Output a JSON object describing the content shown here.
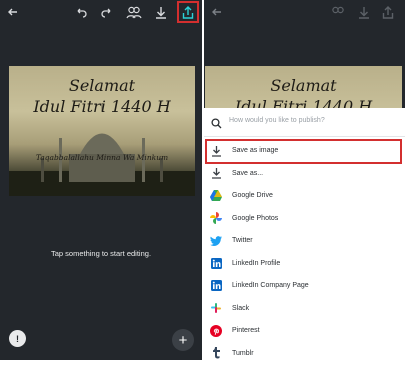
{
  "left": {
    "design": {
      "line1": "Selamat",
      "line2": "Idul Fitri 1440 H",
      "line3": "Taqabbalallahu Minna Wa Minkum"
    },
    "hint": "Tap something to start editing.",
    "fab_left": "!",
    "fab_right": "+"
  },
  "right": {
    "design": {
      "line1": "Selamat",
      "line2": "Idul Fitri 1440 H"
    }
  },
  "sheet": {
    "search_placeholder": "How would you like to publish?",
    "items": [
      {
        "label": "Save as image",
        "icon": "download-icon",
        "color": "#3a3f45"
      },
      {
        "label": "Save as...",
        "icon": "download-icon",
        "color": "#3a3f45"
      },
      {
        "label": "Google Drive",
        "icon": "google-drive-icon",
        "color": "#34a853"
      },
      {
        "label": "Google Photos",
        "icon": "google-photos-icon",
        "color": "#fbbc05"
      },
      {
        "label": "Twitter",
        "icon": "twitter-icon",
        "color": "#1da1f2"
      },
      {
        "label": "LinkedIn Profile",
        "icon": "linkedin-icon",
        "color": "#0a66c2"
      },
      {
        "label": "LinkedIn Company Page",
        "icon": "linkedin-icon",
        "color": "#0a66c2"
      },
      {
        "label": "Slack",
        "icon": "slack-icon",
        "color": "#e01e5a"
      },
      {
        "label": "Pinterest",
        "icon": "pinterest-icon",
        "color": "#e60023"
      },
      {
        "label": "Tumblr",
        "icon": "tumblr-icon",
        "color": "#35465c"
      }
    ]
  }
}
